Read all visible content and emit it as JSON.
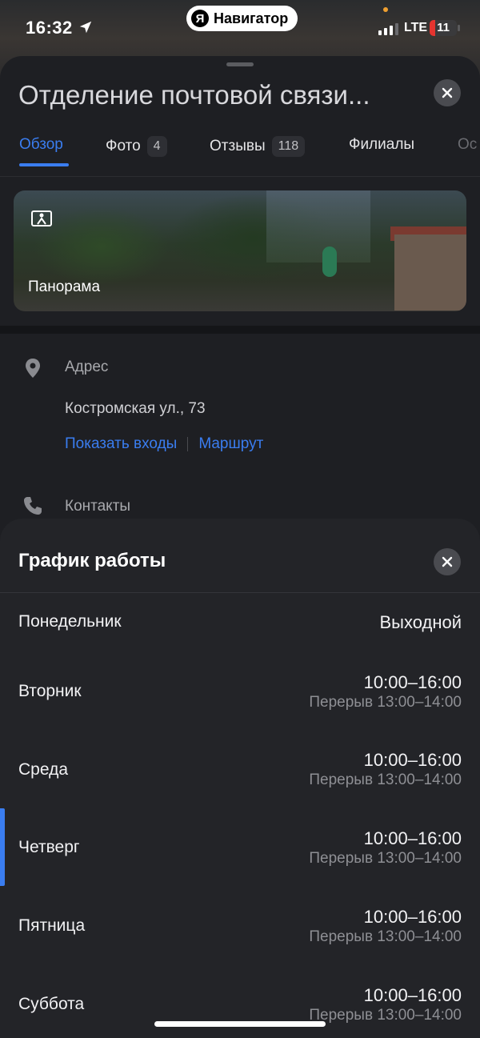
{
  "status_bar": {
    "time": "16:32",
    "app_name": "Навигатор",
    "app_logo_letter": "Я",
    "network": "LTE",
    "battery": "11"
  },
  "place": {
    "title": "Отделение почтовой связи...",
    "tabs": [
      {
        "label": "Обзор",
        "badge": ""
      },
      {
        "label": "Фото",
        "badge": "4"
      },
      {
        "label": "Отзывы",
        "badge": "118"
      },
      {
        "label": "Филиалы",
        "badge": ""
      },
      {
        "label": "Ос",
        "badge": ""
      }
    ],
    "panorama_label": "Панорама",
    "address_label": "Адрес",
    "address_value": "Костромская ул., 73",
    "show_entrances": "Показать входы",
    "route": "Маршрут",
    "contacts_label": "Контакты"
  },
  "schedule": {
    "title": "График работы",
    "days": [
      {
        "name": "Понедельник",
        "hours": "Выходной",
        "break": ""
      },
      {
        "name": "Вторник",
        "hours": "10:00–16:00",
        "break": "Перерыв 13:00–14:00"
      },
      {
        "name": "Среда",
        "hours": "10:00–16:00",
        "break": "Перерыв 13:00–14:00"
      },
      {
        "name": "Четверг",
        "hours": "10:00–16:00",
        "break": "Перерыв 13:00–14:00"
      },
      {
        "name": "Пятница",
        "hours": "10:00–16:00",
        "break": "Перерыв 13:00–14:00"
      },
      {
        "name": "Суббота",
        "hours": "10:00–16:00",
        "break": "Перерыв 13:00–14:00"
      }
    ],
    "today": "Четверг"
  },
  "colors": {
    "accent": "#3a7df0",
    "card_bg": "#1e1f23",
    "sheet_bg": "#232428",
    "battery_low": "#e5342f"
  }
}
